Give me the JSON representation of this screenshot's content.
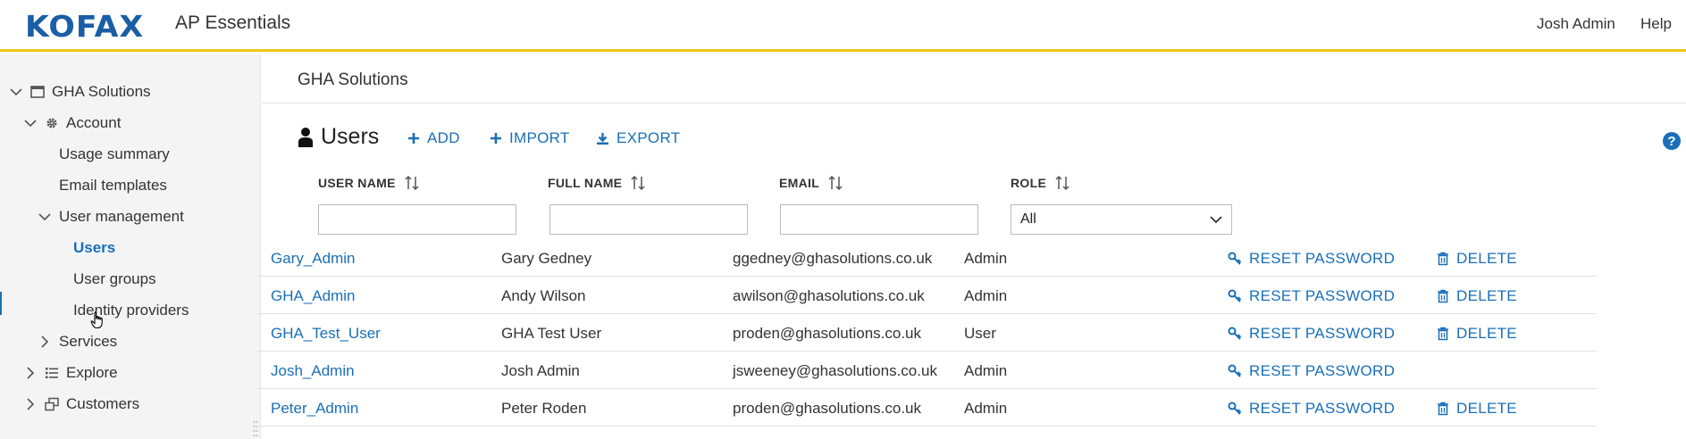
{
  "header": {
    "logo_text": "KOFAX",
    "app_name": "AP Essentials",
    "user_name": "Josh Admin",
    "help_label": "Help",
    "accent_color": "#f2c418",
    "brand_color": "#1a5ea6"
  },
  "sidebar": {
    "items": [
      {
        "label": "GHA Solutions",
        "icon": "window-icon",
        "expanded": true
      },
      {
        "label": "Account",
        "icon": "gear-icon",
        "expanded": true
      },
      {
        "label": "Usage summary"
      },
      {
        "label": "Email templates"
      },
      {
        "label": "User management",
        "expanded": true
      },
      {
        "label": "Users",
        "active": true
      },
      {
        "label": "User groups"
      },
      {
        "label": "Identity providers"
      },
      {
        "label": "Services",
        "expanded": false
      },
      {
        "label": "Explore",
        "icon": "list-icon",
        "expanded": false
      },
      {
        "label": "Customers",
        "icon": "customers-icon",
        "expanded": false
      }
    ]
  },
  "main": {
    "breadcrumb": "GHA Solutions",
    "title": "Users",
    "actions": {
      "add": "ADD",
      "import": "IMPORT",
      "export": "EXPORT"
    },
    "columns": {
      "username": "USER NAME",
      "fullname": "FULL NAME",
      "email": "EMAIL",
      "role": "ROLE"
    },
    "role_filter": "All",
    "reset_label": "RESET PASSWORD",
    "delete_label": "DELETE",
    "rows": [
      {
        "username": "Gary_Admin",
        "fullname": "Gary Gedney",
        "email": "ggedney@ghasolutions.co.uk",
        "role": "Admin",
        "can_delete": true
      },
      {
        "username": "GHA_Admin",
        "fullname": "Andy Wilson",
        "email": "awilson@ghasolutions.co.uk",
        "role": "Admin",
        "can_delete": true
      },
      {
        "username": "GHA_Test_User",
        "fullname": "GHA Test User",
        "email": "proden@ghasolutions.co.uk",
        "role": "User",
        "can_delete": true
      },
      {
        "username": "Josh_Admin",
        "fullname": "Josh Admin",
        "email": "jsweeney@ghasolutions.co.uk",
        "role": "Admin",
        "can_delete": false
      },
      {
        "username": "Peter_Admin",
        "fullname": "Peter Roden",
        "email": "proden@ghasolutions.co.uk",
        "role": "Admin",
        "can_delete": true
      }
    ]
  }
}
